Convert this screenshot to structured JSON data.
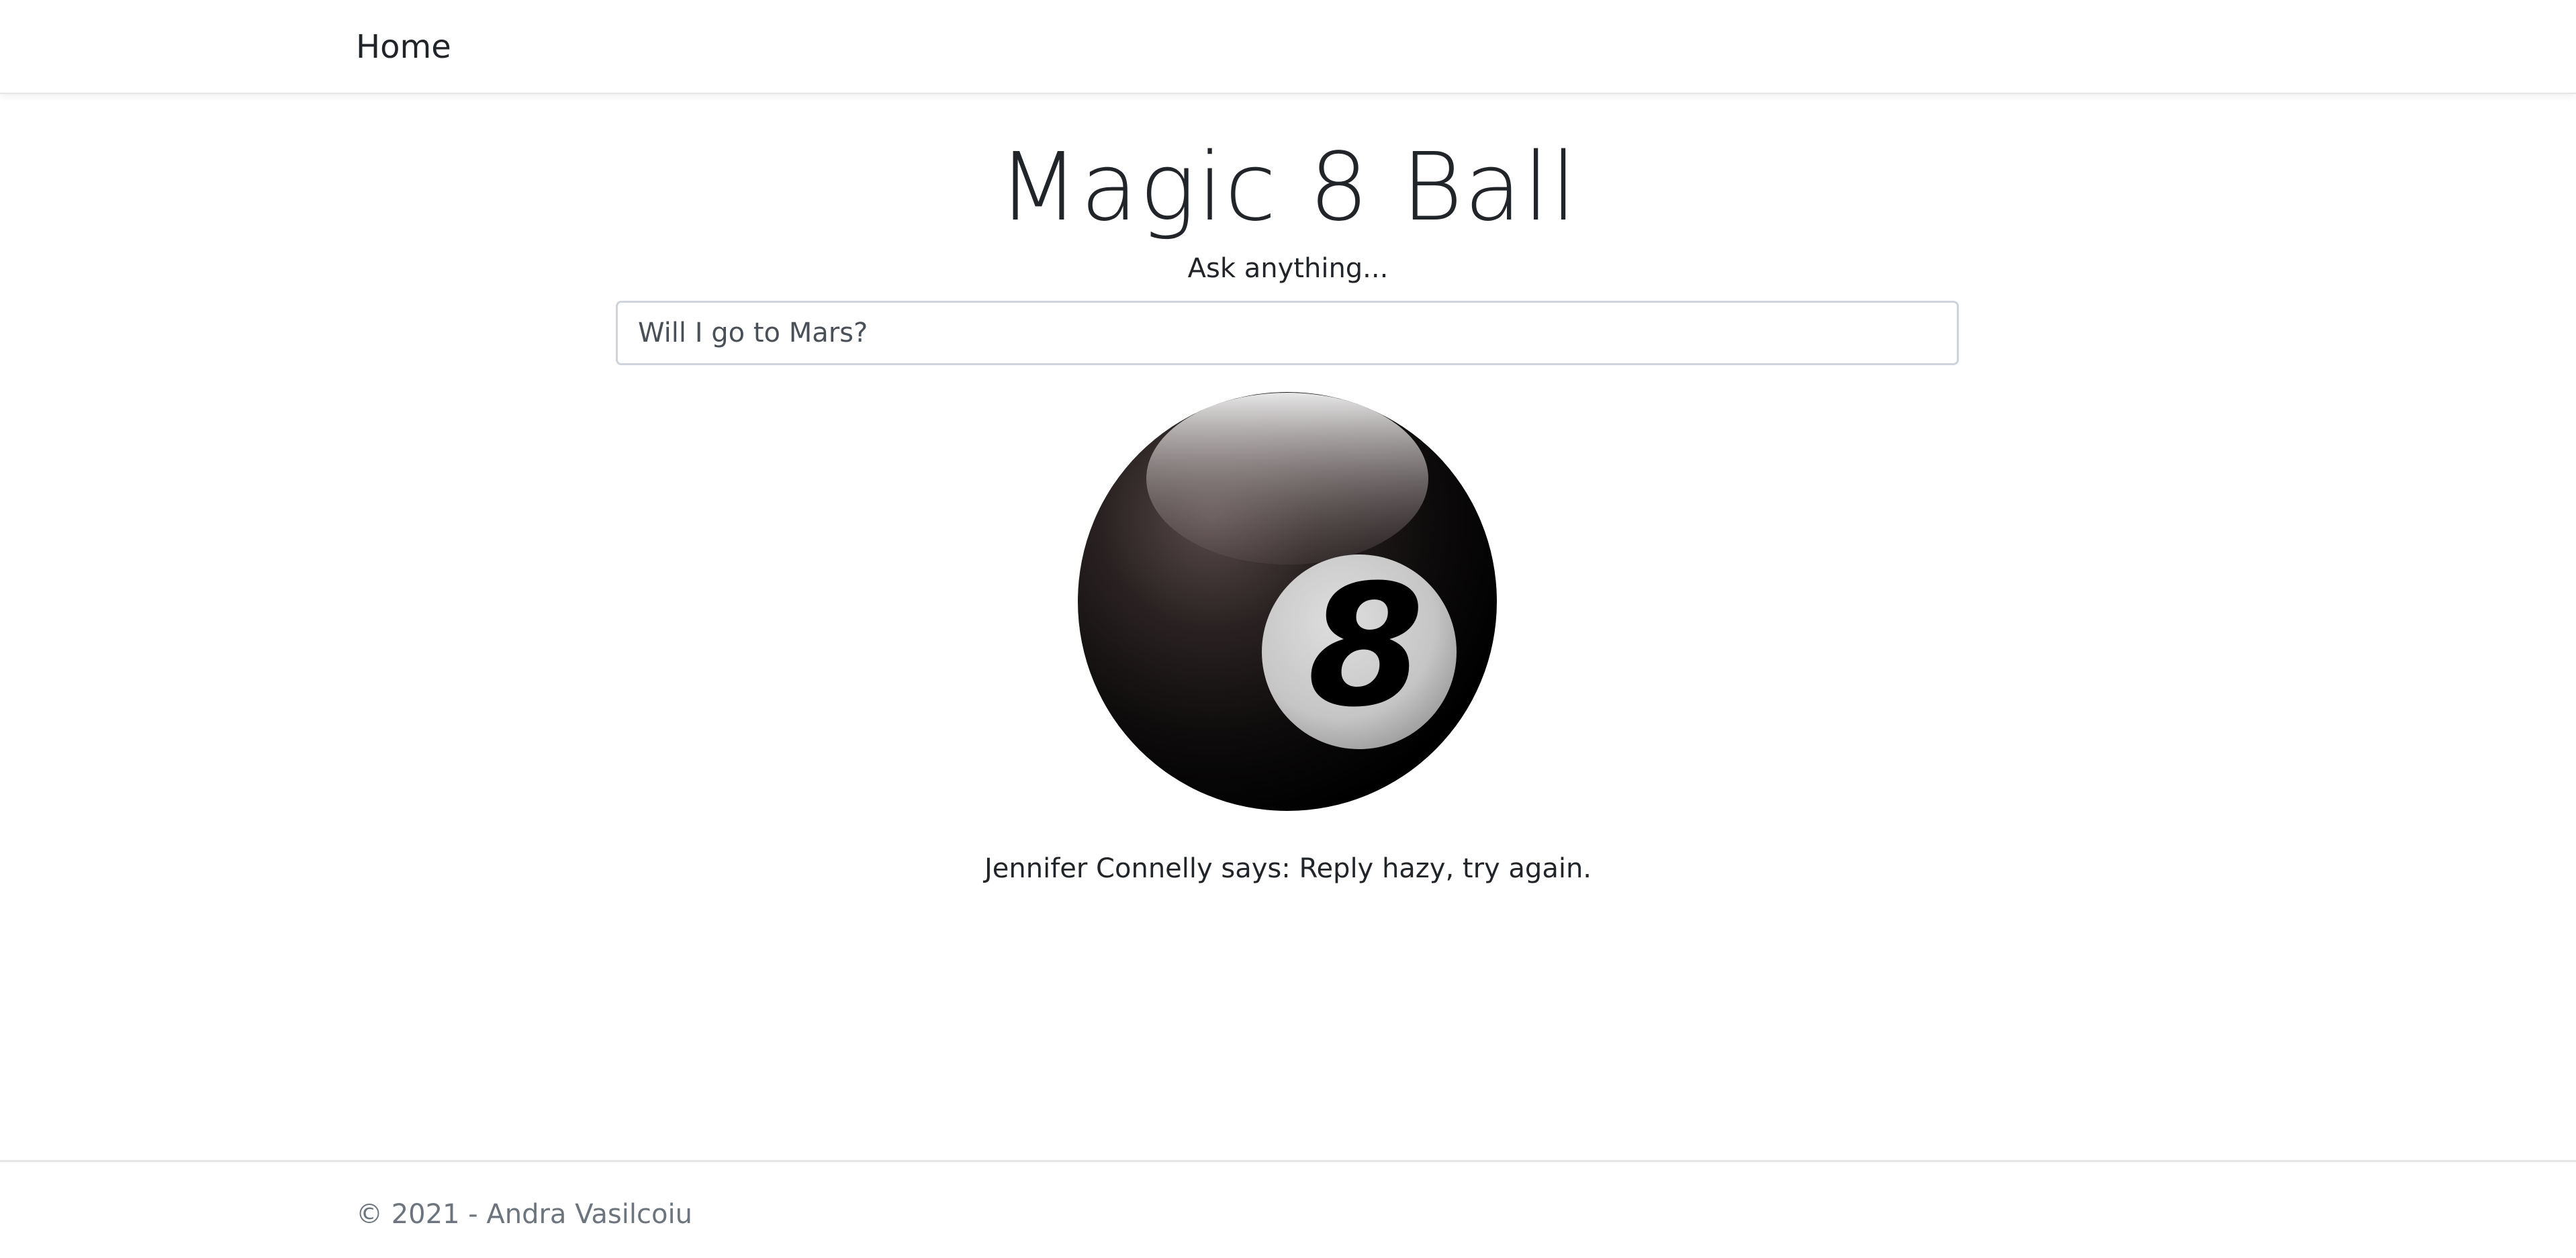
{
  "navbar": {
    "brand": "Home"
  },
  "main": {
    "title": "Magic 8 Ball",
    "prompt": "Ask anything...",
    "question_value": "Will I go to Mars?",
    "ball": {
      "number": "8",
      "icon": "magic-8-ball-icon",
      "colors": {
        "body": "#000000",
        "highlight": "#8a7f7f",
        "face": "#c9c9c9"
      }
    },
    "answer": "Jennifer Connelly says: Reply hazy, try again."
  },
  "footer": {
    "copyright": "© 2021 - Andra Vasilcoiu"
  }
}
